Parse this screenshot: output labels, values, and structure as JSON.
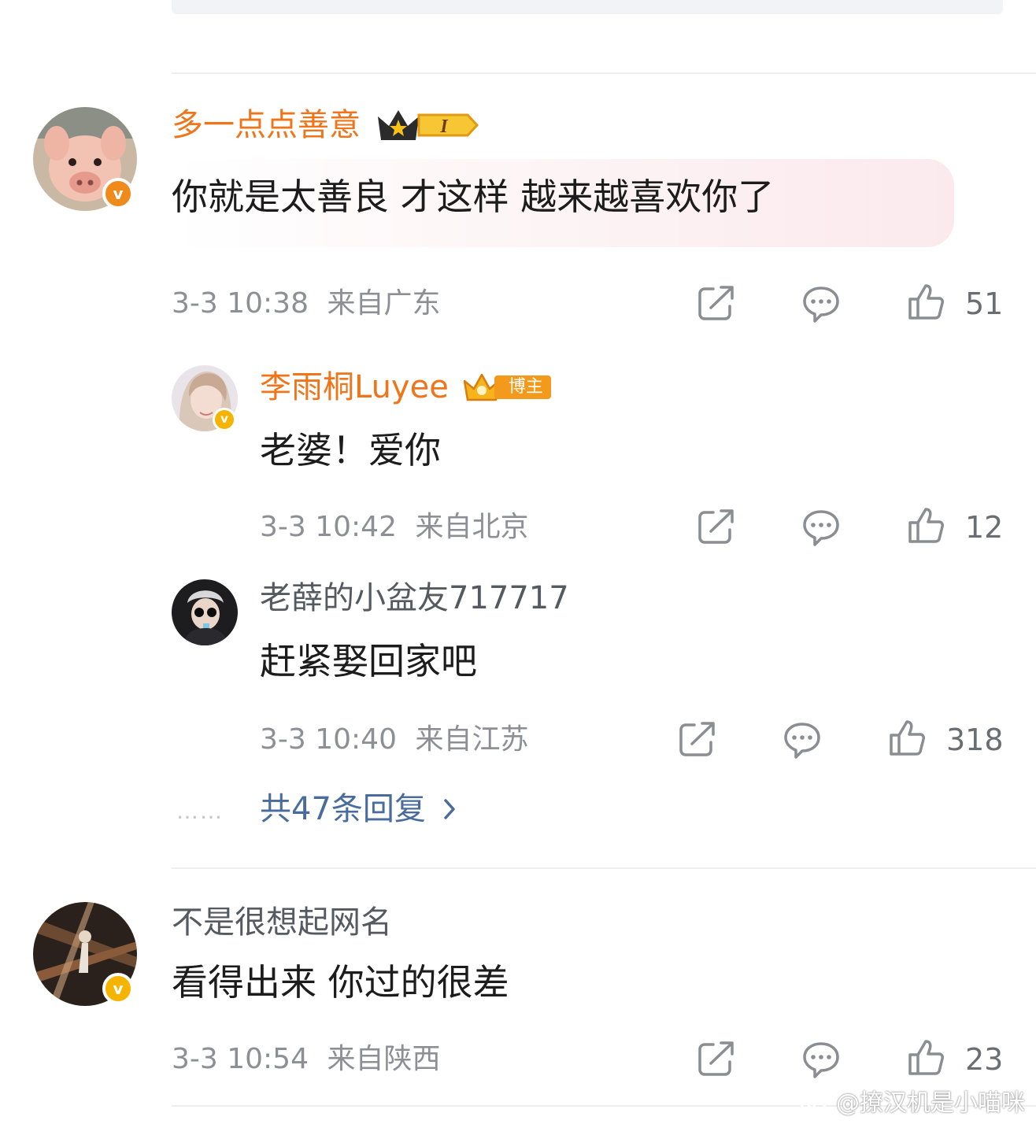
{
  "colors": {
    "vip_name": "#f0751a",
    "plain_name": "#555a60",
    "link": "#4a6c9c",
    "meta": "#8c8f94"
  },
  "comments": [
    {
      "user": "多一点点善意",
      "text": "你就是太善良 才这样  越来越喜欢你了",
      "time": "3-3 10:38",
      "location": "来自广东",
      "likes": "51",
      "badge_label": "I"
    },
    {
      "user": "不是很想起网名",
      "text": "看得出来 你过的很差",
      "time": "3-3 10:54",
      "location": "来自陕西",
      "likes": "23"
    }
  ],
  "replies": [
    {
      "user": "李雨桐Luyee",
      "tag": "博主",
      "text": "老婆！爱你",
      "time": "3-3 10:42",
      "location": "来自北京",
      "likes": "12"
    },
    {
      "user": "老薛的小盆友717717",
      "text": "赶紧娶回家吧",
      "time": "3-3 10:40",
      "location": "来自江苏",
      "likes": "318"
    }
  ],
  "more_replies": {
    "dots": "……",
    "label": "共47条回复",
    "icon": "chevron-right-icon"
  },
  "icons": {
    "share": "share-icon",
    "reply": "comment-icon",
    "like": "thumbs-up-icon",
    "verified": "verified-v-icon"
  },
  "watermark": "@撩汉机是小喵咪"
}
